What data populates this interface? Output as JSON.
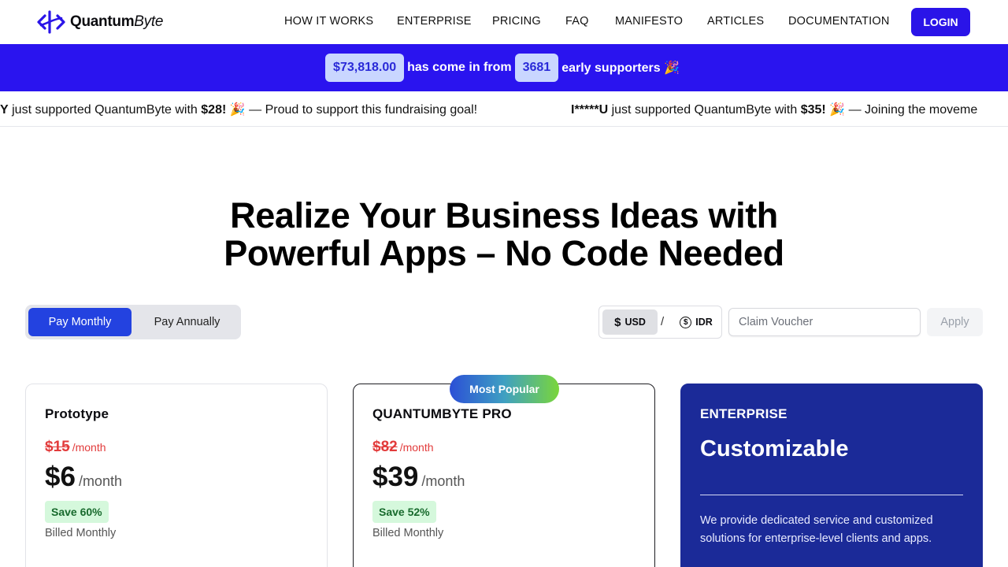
{
  "brand": {
    "name_bold": "Quantum",
    "name_italic": "Byte"
  },
  "nav": {
    "items": [
      "HOW IT WORKS",
      "ENTERPRISE",
      "PRICING",
      "FAQ",
      "MANIFESTO",
      "ARTICLES",
      "DOCUMENTATION"
    ],
    "login": "LOGIN"
  },
  "fundraising": {
    "amount": "$73,818.00",
    "text_mid": "has come in from",
    "supporters": "3681",
    "text_end": "early supporters 🎉"
  },
  "ticker": [
    {
      "name": "Y",
      "text_mid": "just supported QuantumByte with",
      "amount": "$28!",
      "message": "🎉 — Proud to support this fundraising goal!"
    },
    {
      "name": "I*****U",
      "text_mid": "just supported QuantumByte with",
      "amount": "$35!",
      "message": "🎉 — Joining the moveme"
    }
  ],
  "hero": {
    "line1": "Realize Your Business Ideas with",
    "line2": "Powerful Apps – No Code Needed"
  },
  "billing": {
    "monthly": "Pay Monthly",
    "annually": "Pay Annually",
    "selected": "monthly"
  },
  "currency": {
    "usd": "USD",
    "separator": "/",
    "idr": "IDR",
    "selected": "USD"
  },
  "voucher": {
    "placeholder": "Claim Voucher",
    "apply": "Apply"
  },
  "plans": [
    {
      "title": "Prototype",
      "old_price": "$15",
      "old_per": "/month",
      "price": "$6",
      "per": "/month",
      "save": "Save 60%",
      "billed": "Billed Monthly"
    },
    {
      "title": "QUANTUMBYTE PRO",
      "badge": "Most Popular",
      "old_price": "$82",
      "old_per": "/month",
      "price": "$39",
      "per": "/month",
      "save": "Save 52%",
      "billed": "Billed Monthly"
    },
    {
      "title": "ENTERPRISE",
      "heading": "Customizable",
      "description": "We provide dedicated service and customized solutions for enterprise-level clients and apps."
    }
  ],
  "colors": {
    "accent": "#2a14ef",
    "enterprise_bg": "#1b2a98",
    "save_bg": "#d5f8dc",
    "old_price": "#e23b3b"
  }
}
